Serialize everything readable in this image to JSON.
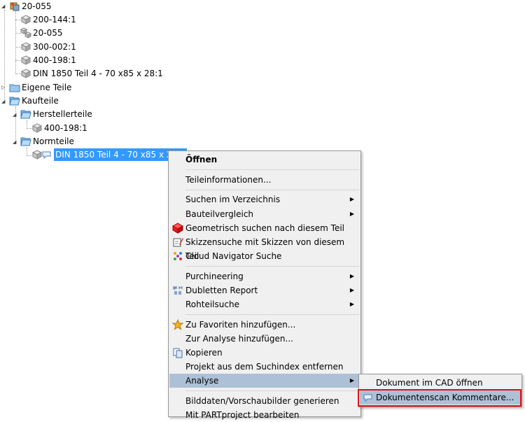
{
  "tree": {
    "root": "20-055",
    "root_children": [
      "200-144:1",
      "20-055",
      "300-002:1",
      "400-198:1",
      "DIN 1850 Teil 4 - 70 x85 x 28:1"
    ],
    "own_parts": "Eigene Teile",
    "purchased": "Kaufteile",
    "manufacturer_parts": "Herstellerteile",
    "manufacturer_child": "400-198:1",
    "standard_parts": "Normteile",
    "selected_item": "DIN 1850 Teil 4 - 70 x85 x 28:1"
  },
  "context_menu": {
    "open": "Öffnen",
    "part_info": "Teileinformationen...",
    "search_dir": "Suchen im Verzeichnis",
    "component_compare": "Bauteilvergleich",
    "geo_search": "Geometrisch suchen nach diesem Teil",
    "sketch_search": "Skizzensuche mit Skizzen von diesem Teil",
    "cloud_search": "Cloud Navigator Suche",
    "purchineering": "Purchineering",
    "duplicates": "Dubletten Report",
    "raw_search": "Rohteilsuche",
    "add_fav": "Zu Favoriten hinzufügen...",
    "add_analysis": "Zur Analyse hinzufügen...",
    "copy": "Kopieren",
    "remove_index": "Projekt aus dem Suchindex entfernen",
    "analysis": "Analyse",
    "gen_images": "Bilddaten/Vorschaubilder generieren",
    "edit_partproject": "Mit PARTproject bearbeiten"
  },
  "submenu": {
    "open_cad": "Dokument im CAD öffnen",
    "docscan": "Dokumentenscan Kommentare..."
  },
  "colors": {
    "selection": "#3399ff",
    "menu_highlight": "#adc0d6",
    "callout": "#e0101a"
  }
}
